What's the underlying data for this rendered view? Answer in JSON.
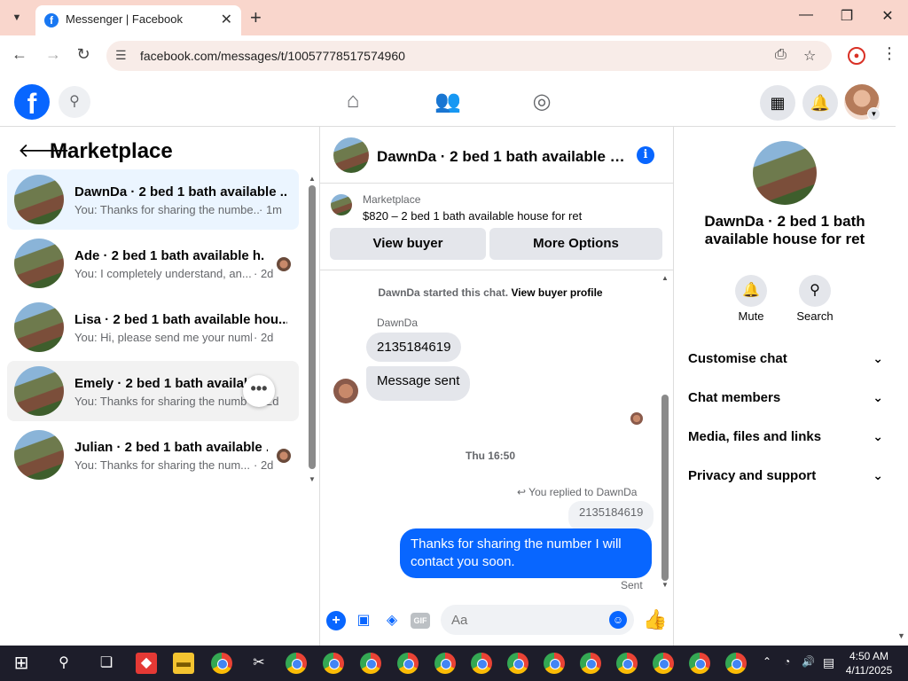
{
  "browser": {
    "tab_title": "Messenger | Facebook",
    "url": "facebook.com/messages/t/10057778517574960"
  },
  "left": {
    "title": "Marketplace",
    "conversations": [
      {
        "name": "DawnDa · 2 bed 1 bath available ...",
        "preview": "You: Thanks for sharing the numbe...",
        "time": "· 1m"
      },
      {
        "name": "Ade · 2 bed 1 bath available h...",
        "preview": "You: I completely understand, an...",
        "time": "· 2d"
      },
      {
        "name": "Lisa · 2 bed 1 bath available hou...",
        "preview": "You: Hi, please send me your numb...",
        "time": "· 2d"
      },
      {
        "name": "Emely · 2 bed 1 bath availabl",
        "preview": "You: Thanks for sharing the numb",
        "time": "2d"
      },
      {
        "name": "Julian · 2 bed 1 bath available ...",
        "preview": "You: Thanks for sharing the num...",
        "time": "· 2d"
      }
    ],
    "more_glyph": "•••"
  },
  "chat": {
    "title": "DawnDa · 2 bed 1 bath available house for ret",
    "listing_category": "Marketplace",
    "listing_price": "$820 – 2 bed 1 bath available house for ret",
    "view_buyer_label": "View buyer",
    "more_options_label": "More Options",
    "started_text": "DawnDa started this chat.",
    "view_profile_text": "View buyer profile",
    "sender_name": "DawnDa",
    "msg1": "2135184619",
    "msg2": "Message sent",
    "day_label": "Thu 16:50",
    "replied_text": "You replied to DawnDa",
    "quoted": "2135184619",
    "reply": "Thanks for sharing the number I will contact you soon.",
    "status": "Sent",
    "input_placeholder": "Aa",
    "gif_label": "GIF"
  },
  "right": {
    "title": "DawnDa · 2 bed 1 bath available house for ret",
    "mute_label": "Mute",
    "search_label": "Search",
    "sections": [
      "Customise chat",
      "Chat members",
      "Media, files and links",
      "Privacy and support"
    ]
  },
  "taskbar": {
    "time": "4:50 AM",
    "date": "4/11/2025"
  },
  "colors": {
    "accent": "#0866ff",
    "tabbar": "#f9d6cc"
  }
}
